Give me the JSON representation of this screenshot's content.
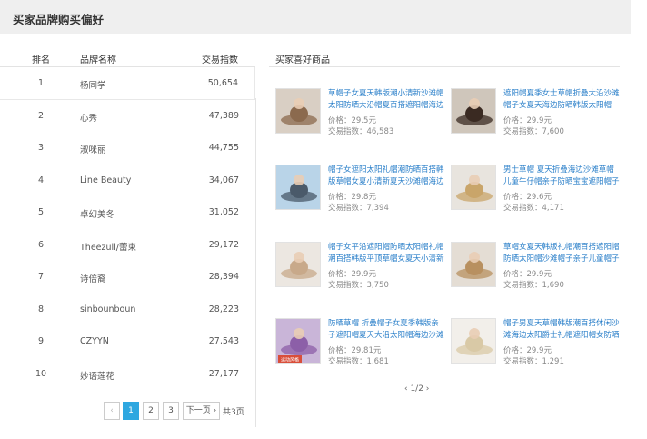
{
  "page_title": "买家品牌购买偏好",
  "table": {
    "headers": {
      "rank": "排名",
      "brand": "品牌名称",
      "index": "交易指数"
    },
    "rows": [
      {
        "rank": "1",
        "brand": "杨同学",
        "index": "50,654"
      },
      {
        "rank": "2",
        "brand": "心秀",
        "index": "47,389"
      },
      {
        "rank": "3",
        "brand": "淑咪丽",
        "index": "44,755"
      },
      {
        "rank": "4",
        "brand": "Line Beauty",
        "index": "34,067"
      },
      {
        "rank": "5",
        "brand": "卓幻美冬",
        "index": "31,052"
      },
      {
        "rank": "6",
        "brand": "Theezull/蕾束",
        "index": "29,172"
      },
      {
        "rank": "7",
        "brand": "诗倍裔",
        "index": "28,394"
      },
      {
        "rank": "8",
        "brand": "sinbounboun",
        "index": "28,223"
      },
      {
        "rank": "9",
        "brand": "CZYYN",
        "index": "27,543"
      },
      {
        "rank": "10",
        "brand": "妙语莲花",
        "index": "27,177"
      }
    ]
  },
  "pagination": {
    "prev": "‹",
    "pages": [
      "1",
      "2",
      "3"
    ],
    "current": "1",
    "next": "下一页 ›",
    "total": "共3页"
  },
  "favorites": {
    "heading": "买家喜好商品",
    "price_label": "价格：",
    "index_label": "交易指数：",
    "items": [
      {
        "title": "草帽子女夏天韩版潮小清新沙滩帽太阳防晒大沿帽夏百搭遮阳帽海边",
        "price": "29.5元",
        "index": "46,583",
        "thumb_bg": "#d9cfc4",
        "thumb_fg": "#8b6a4e"
      },
      {
        "title": "遮阳帽夏季女士草帽折叠大沿沙滩帽子女夏天海边防晒韩版太阳帽",
        "price": "29.9元",
        "index": "7,600",
        "thumb_bg": "#cfc6bb",
        "thumb_fg": "#3a2a22"
      },
      {
        "title": "帽子女遮阳太阳礼帽潮防晒百搭韩版草帽女夏小清新夏天沙滩帽海边",
        "price": "29.8元",
        "index": "7,394",
        "thumb_bg": "#b9d4e8",
        "thumb_fg": "#4a5a6a"
      },
      {
        "title": "男士草帽 夏天折叠海边沙滩草帽儿童牛仔帽亲子防晒宝宝遮阳帽子",
        "price": "29.6元",
        "index": "4,171",
        "thumb_bg": "#e8e4de",
        "thumb_fg": "#c9a56a"
      },
      {
        "title": "帽子女平沿遮阳帽防晒太阳帽礼帽潮百搭韩版平顶草帽女夏天小清新",
        "price": "29.9元",
        "index": "3,750",
        "thumb_bg": "#ece7e1",
        "thumb_fg": "#c8a98a"
      },
      {
        "title": "草帽女夏天韩版礼帽潮百搭遮阳帽防晒太阳帽沙滩帽子亲子儿童帽子",
        "price": "29.9元",
        "index": "1,690",
        "thumb_bg": "#e4ddd4",
        "thumb_fg": "#b89060"
      },
      {
        "title": "防晒草帽 折叠帽子女夏季韩版亲子遮阳帽夏天大沿太阳帽海边沙滩帽",
        "price": "29.81元",
        "index": "1,681",
        "thumb_bg": "#c9b5d8",
        "thumb_fg": "#8c5fa8"
      },
      {
        "title": "帽子男夏天草帽韩版潮百搭休闲沙滩海边太阳爵士礼帽遮阳帽女防晒",
        "price": "29.9元",
        "index": "1,291",
        "thumb_bg": "#f2efea",
        "thumb_fg": "#d9c9a6"
      }
    ],
    "thumb_badge": "运动风格",
    "page_indicator": "‹ 1/2 ›"
  }
}
